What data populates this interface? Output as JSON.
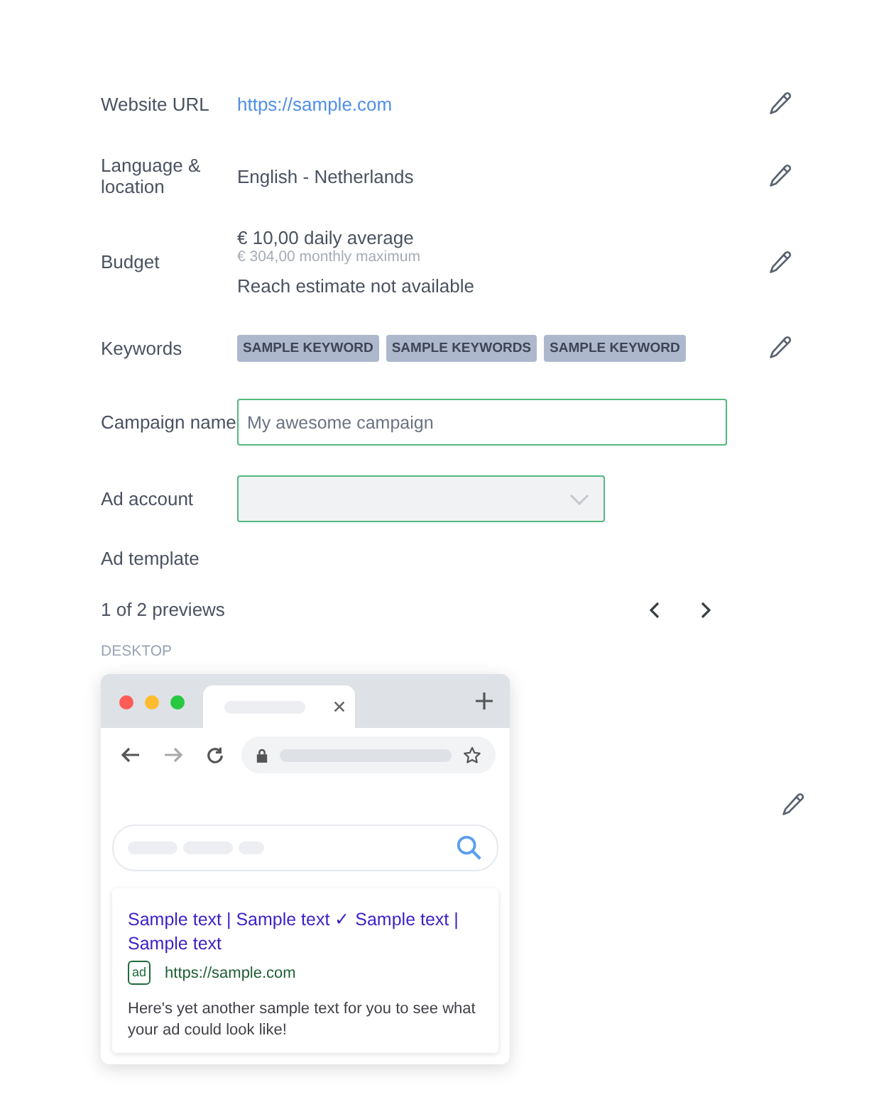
{
  "rows": [
    {
      "kind": "link",
      "label": "Website URL",
      "value": "https://sample.com",
      "editable": true
    },
    {
      "kind": "text",
      "label": "Language & location",
      "value": "English - Netherlands",
      "editable": true
    },
    {
      "kind": "budget",
      "label": "Budget",
      "value": "€ 10,00 daily average",
      "sub": "€ 304,00 monthly maximum",
      "note": "Reach estimate not available",
      "editable": true
    },
    {
      "kind": "keywords",
      "label": "Keywords",
      "tags": [
        "SAMPLE KEYWORD",
        "SAMPLE KEYWORDS",
        "SAMPLE KEYWORD"
      ],
      "editable": true
    },
    {
      "kind": "input",
      "label": "Campaign name",
      "placeholder": "My awesome campaign",
      "editable": false
    },
    {
      "kind": "select",
      "label": "Ad account",
      "editable": false
    }
  ],
  "ad_template": {
    "label": "Ad template",
    "pager": "1 of 2 previews",
    "device": "DESKTOP",
    "editable": true,
    "ad": {
      "title": "Sample text | Sample text ✓ Sample text | Sample text",
      "badge": "ad",
      "url": "https://sample.com",
      "description": "Here's yet another sample text for you to see what your ad could look like!"
    }
  }
}
